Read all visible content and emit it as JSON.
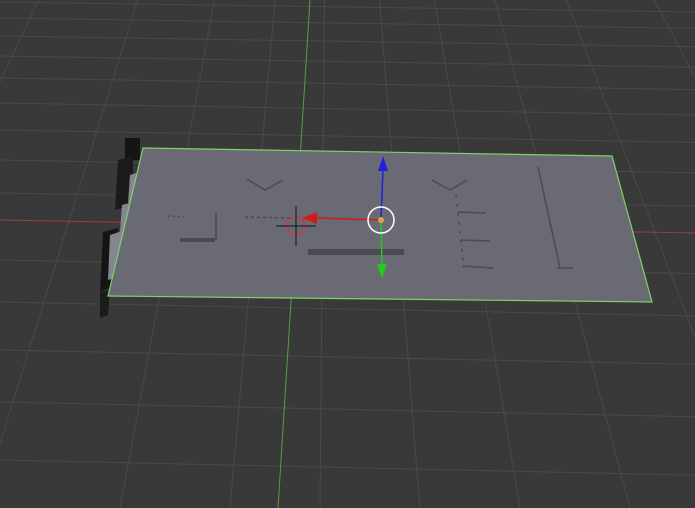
{
  "app": {
    "editor": "3D Viewport"
  },
  "colors": {
    "background": "#393939",
    "grid_line": "#4a4a4a",
    "axis_x": "#a23a3a",
    "axis_y": "#5c9a45",
    "mesh_face": "#6a6a74",
    "mesh_face_dark": "#5c5c66",
    "mesh_detail": "#4a4a52",
    "selection_outline": "#7dd36a",
    "gizmo_x": "#d21a1a",
    "gizmo_y": "#1ecc1e",
    "gizmo_z": "#2020dd",
    "gizmo_center": "#ffffff",
    "origin_dot": "#e0a050",
    "cursor_red": "#e03030",
    "cursor_white": "#ffffff"
  },
  "scene": {
    "selected_object": "plane-mesh",
    "objects": [
      {
        "name": "plane-mesh",
        "selected": true
      },
      {
        "name": "connector-blocks",
        "selected": false
      }
    ]
  },
  "gizmo": {
    "mode": "translate",
    "axes": [
      "x",
      "y",
      "z"
    ]
  }
}
